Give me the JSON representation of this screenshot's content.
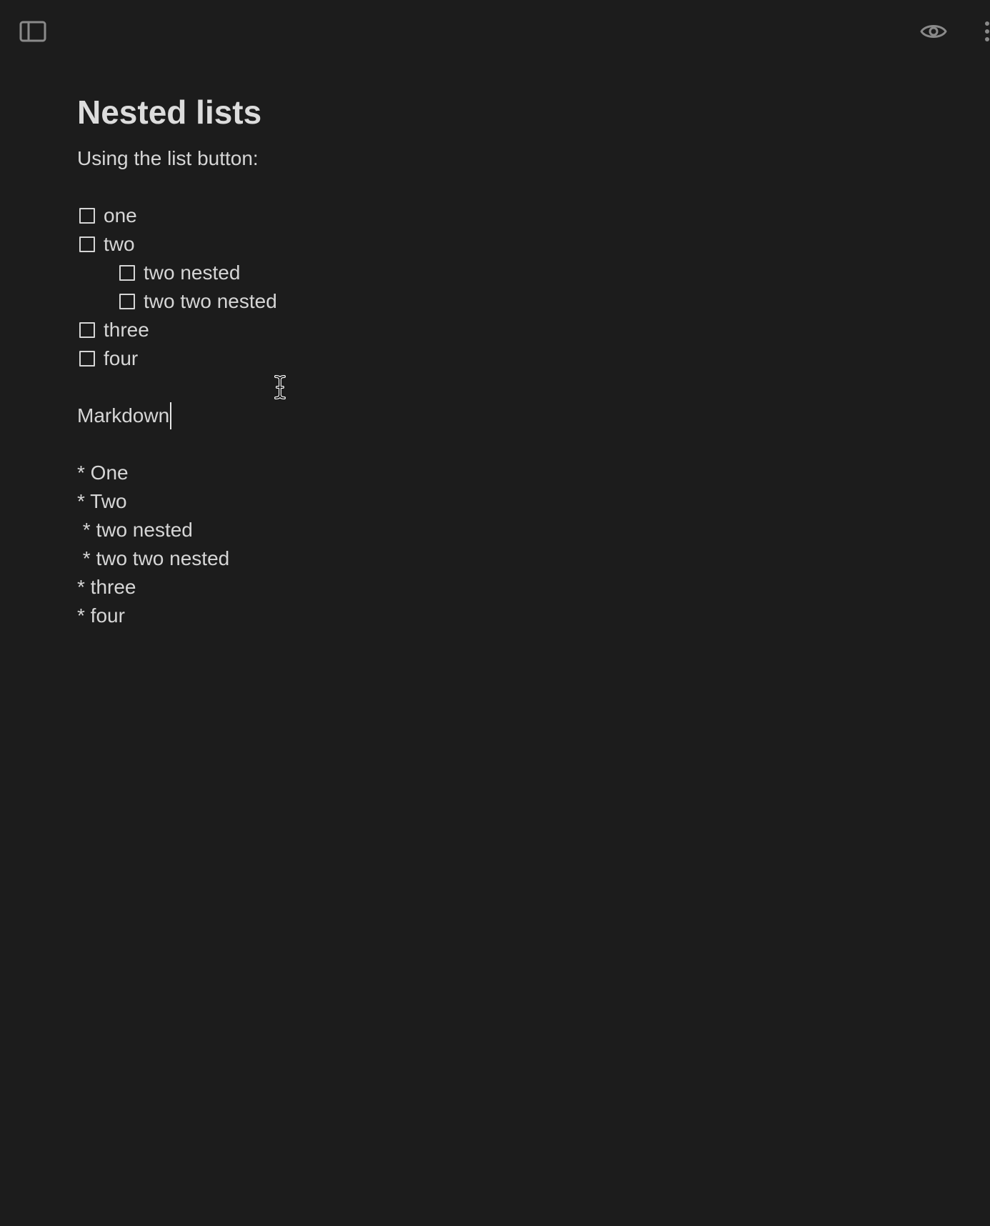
{
  "toolbar": {
    "sidebar_icon": "sidebar-toggle-icon",
    "preview_icon": "eye-icon",
    "more_icon": "more-options-icon"
  },
  "document": {
    "title": "Nested lists",
    "intro": "Using the list button:",
    "task_list": [
      {
        "label": "one",
        "checked": false
      },
      {
        "label": "two",
        "checked": false
      },
      {
        "label": "two nested",
        "checked": false
      },
      {
        "label": "two two nested",
        "checked": false
      },
      {
        "label": "three",
        "checked": false
      },
      {
        "label": "four",
        "checked": false
      }
    ],
    "markdown_heading": "Markdown",
    "markdown_lines": [
      "* One",
      "* Two",
      " * two nested",
      " * two two nested",
      "* three",
      "* four"
    ]
  },
  "colors": {
    "background": "#1c1c1c",
    "text": "#d6d6d6",
    "icon": "#8a8a8a"
  }
}
